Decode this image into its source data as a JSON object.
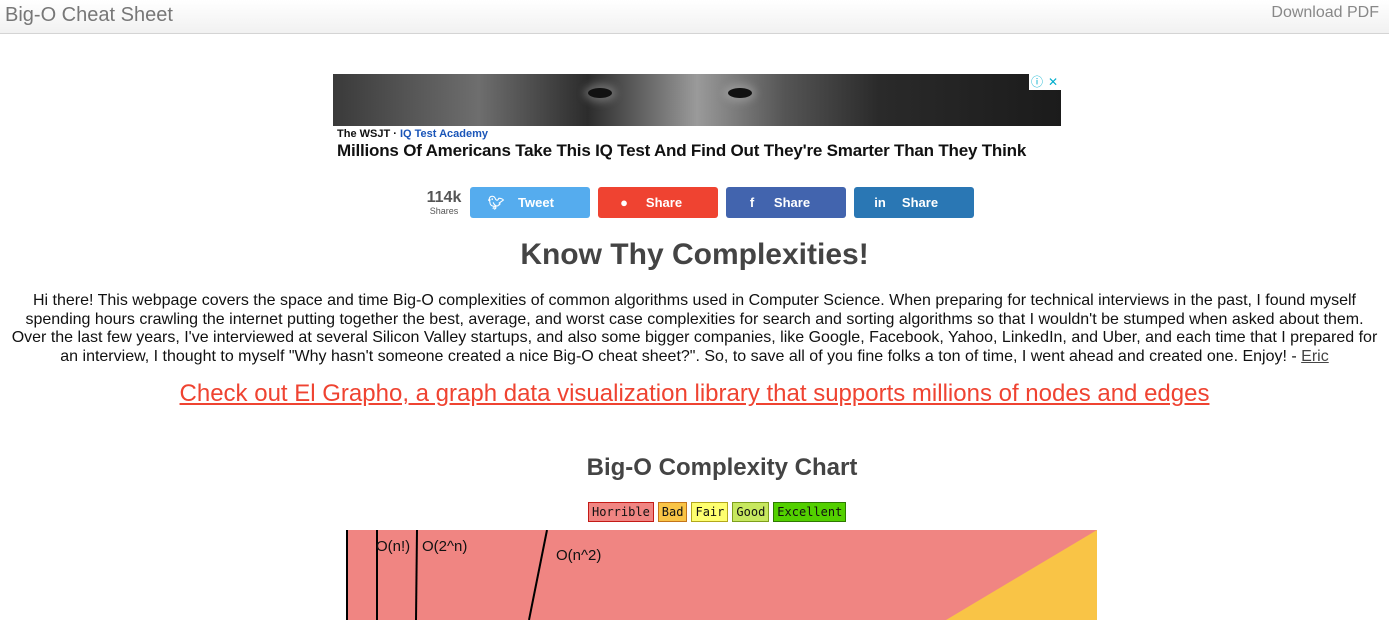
{
  "topbar": {
    "brand": "Big-O Cheat Sheet",
    "download": "Download PDF"
  },
  "ad": {
    "info_icon": "info-icon",
    "close_icon": "close-icon",
    "source": "The WSJT · ",
    "publisher": "IQ Test Academy",
    "headline": "Millions Of Americans Take This IQ Test And Find Out They're Smarter Than They Think"
  },
  "shares": {
    "count": "114k",
    "count_label": "Shares",
    "buttons": [
      {
        "label": "Tweet",
        "icon": "twitter-icon",
        "color": "#55acee"
      },
      {
        "label": "Share",
        "icon": "reddit-icon",
        "color": "#ef4331"
      },
      {
        "label": "Share",
        "icon": "facebook-icon",
        "color": "#4264ae"
      },
      {
        "label": "Share",
        "icon": "linkedin-icon",
        "color": "#2a77b4"
      }
    ]
  },
  "main": {
    "title": "Know Thy Complexities!",
    "intro": "Hi there!  This webpage covers the space and time Big-O complexities of common algorithms used in Computer Science.  When preparing for technical interviews in the past, I found myself spending hours crawling the internet putting together the best, average, and worst case complexities for search and sorting algorithms so that I wouldn't be stumped when asked about them.  Over the last few years, I've interviewed at several Silicon Valley startups, and also some bigger companies, like Google, Facebook, Yahoo, LinkedIn, and Uber, and each time that I prepared for an interview, I thought to myself \"Why hasn't someone created a nice Big-O cheat sheet?\".  So, to save all of you fine folks a ton of time, I went ahead and created one.  Enjoy! - ",
    "author_link": "Eric",
    "promo_link": "Check out El Grapho, a graph data visualization library that supports millions of nodes and edges",
    "chart_title": "Big-O Complexity Chart"
  },
  "legend": [
    {
      "label": "Horrible",
      "color": "#f08582",
      "border": "#c41a16"
    },
    {
      "label": "Bad",
      "color": "#f9c446",
      "border": "#c4751a"
    },
    {
      "label": "Fair",
      "color": "#feff6f",
      "border": "#b3a81b"
    },
    {
      "label": "Good",
      "color": "#c7e85f",
      "border": "#7e9f1c"
    },
    {
      "label": "Excellent",
      "color": "#53d000",
      "border": "#2d7a00"
    }
  ],
  "chart_data": {
    "type": "area",
    "title": "Big-O Complexity Chart",
    "regions": [
      "Horrible",
      "Bad",
      "Fair",
      "Good",
      "Excellent"
    ],
    "curve_labels": [
      "O(n!)",
      "O(2^n)",
      "O(n^2)"
    ],
    "visible_portion": "top"
  }
}
